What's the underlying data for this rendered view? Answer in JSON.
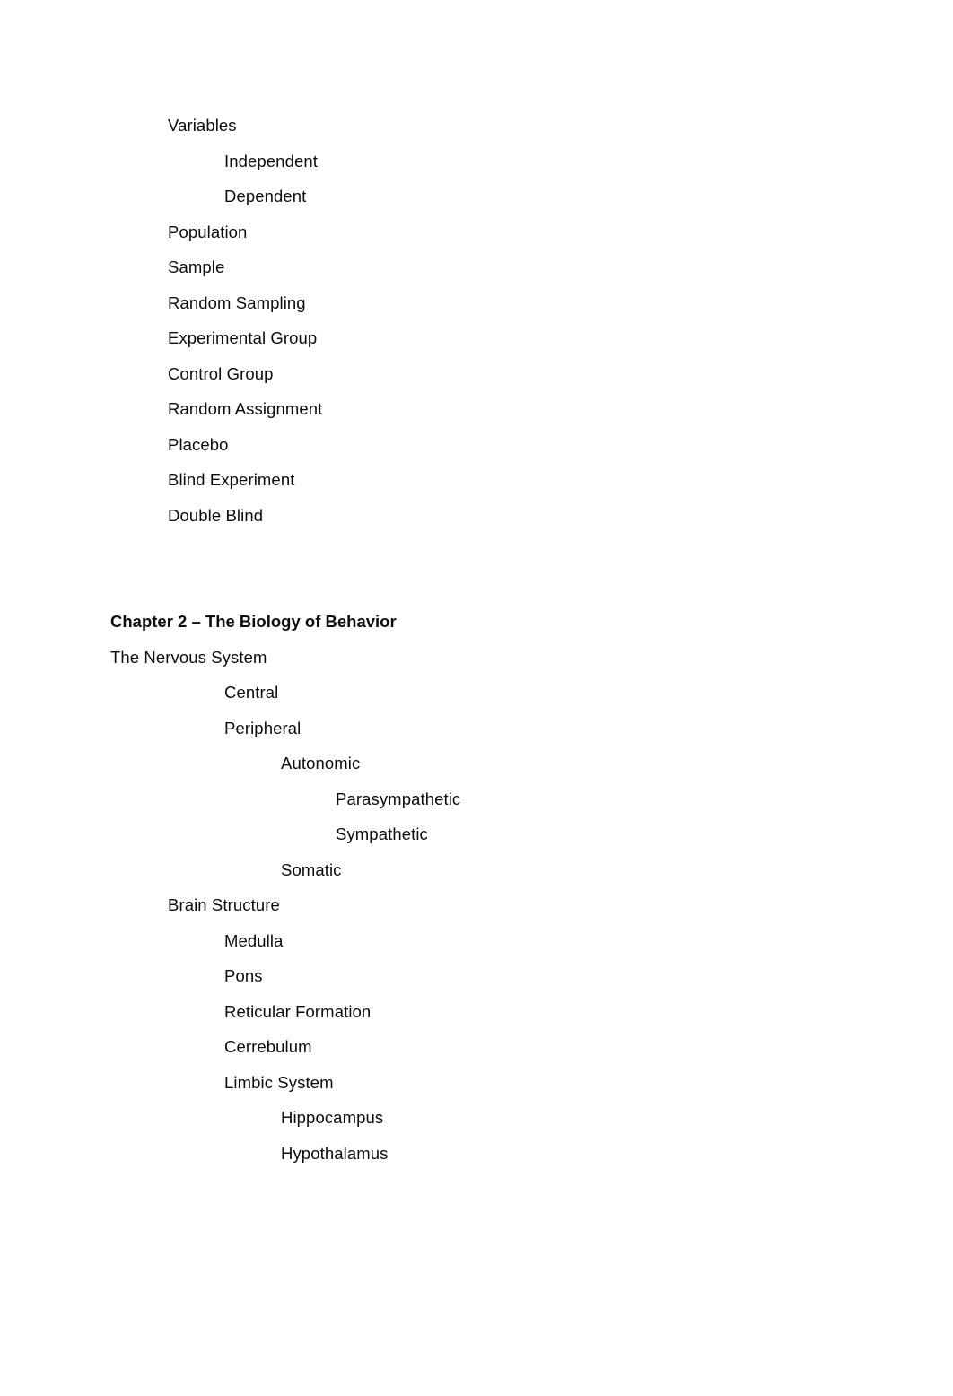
{
  "document": {
    "page_background": "#ffffff",
    "text_color": "#0d0d0d",
    "sections": [
      {
        "id": "chapter-1-continued",
        "items": [
          {
            "text": "Variables",
            "level": 1
          },
          {
            "text": "Independent",
            "level": 2
          },
          {
            "text": "Dependent",
            "level": 2
          },
          {
            "text": "Population",
            "level": 1
          },
          {
            "text": "Sample",
            "level": 1
          },
          {
            "text": "Random Sampling",
            "level": 1
          },
          {
            "text": "Experimental Group",
            "level": 1
          },
          {
            "text": "Control Group",
            "level": 1
          },
          {
            "text": "Random Assignment",
            "level": 1
          },
          {
            "text": "Placebo",
            "level": 1
          },
          {
            "text": "Blind Experiment",
            "level": 1
          },
          {
            "text": "Double Blind",
            "level": 1
          }
        ]
      },
      {
        "id": "chapter-2",
        "heading": "Chapter 2 – The Biology of Behavior",
        "items": [
          {
            "text": "The Nervous System",
            "level": 0
          },
          {
            "text": "Central",
            "level": 2
          },
          {
            "text": "Peripheral",
            "level": 2
          },
          {
            "text": "Autonomic",
            "level": 3
          },
          {
            "text": "Parasympathetic",
            "level": 4
          },
          {
            "text": "Sympathetic",
            "level": 4
          },
          {
            "text": "Somatic",
            "level": 3
          },
          {
            "text": "Brain Structure",
            "level": 1
          },
          {
            "text": "Medulla",
            "level": 2
          },
          {
            "text": "Pons",
            "level": 2
          },
          {
            "text": "Reticular Formation",
            "level": 2
          },
          {
            "text": "Cerrebulum",
            "level": 2
          },
          {
            "text": "Limbic System",
            "level": 2
          },
          {
            "text": "Hippocampus",
            "level": 3
          },
          {
            "text": "Hypothalamus",
            "level": 3
          }
        ]
      }
    ]
  }
}
